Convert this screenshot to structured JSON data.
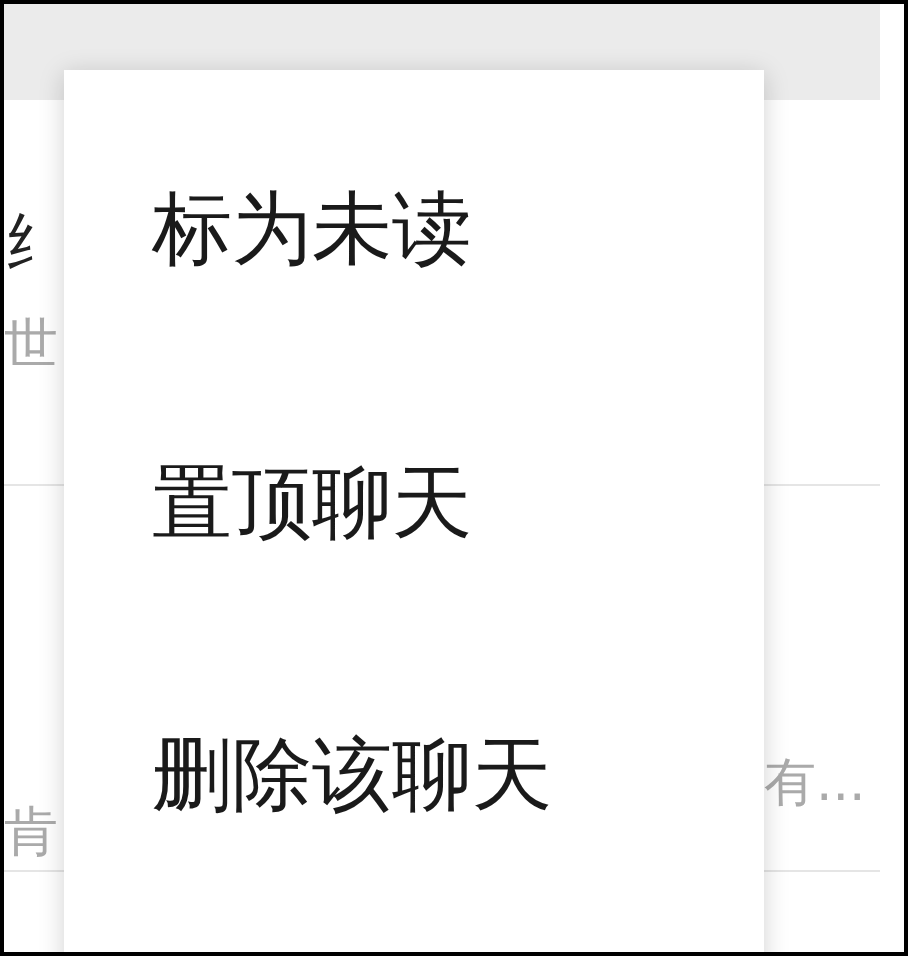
{
  "chat_list": [
    {
      "title": "纟",
      "preview": "世"
    },
    {
      "preview": "肯",
      "preview_end": "有..."
    }
  ],
  "context_menu": {
    "items": [
      {
        "label": "标为未读"
      },
      {
        "label": "置顶聊天"
      },
      {
        "label": "删除该聊天"
      }
    ]
  }
}
